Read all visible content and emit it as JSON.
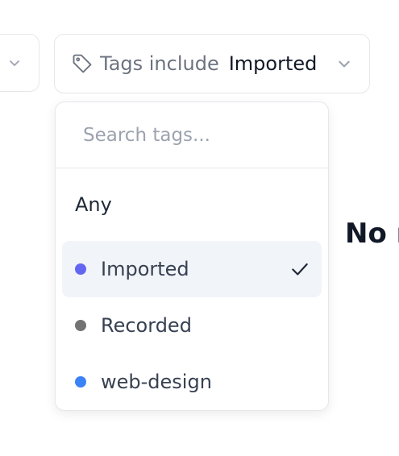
{
  "filters": {
    "left_filter": {
      "icon": "chevron-down-icon"
    },
    "tags_filter": {
      "icon": "tag-icon",
      "prefix": "Tags include",
      "value": "Imported",
      "chevron_icon": "chevron-down-icon"
    }
  },
  "dropdown": {
    "search_placeholder": "Search tags...",
    "search_value": "",
    "any_label": "Any",
    "options": [
      {
        "label": "Imported",
        "color": "#6366f1",
        "selected": true
      },
      {
        "label": "Recorded",
        "color": "#737373",
        "selected": false
      },
      {
        "label": "web-design",
        "color": "#3b82f6",
        "selected": false
      }
    ],
    "check_icon": "check-icon"
  },
  "main": {
    "empty_state_partial": "No r"
  }
}
